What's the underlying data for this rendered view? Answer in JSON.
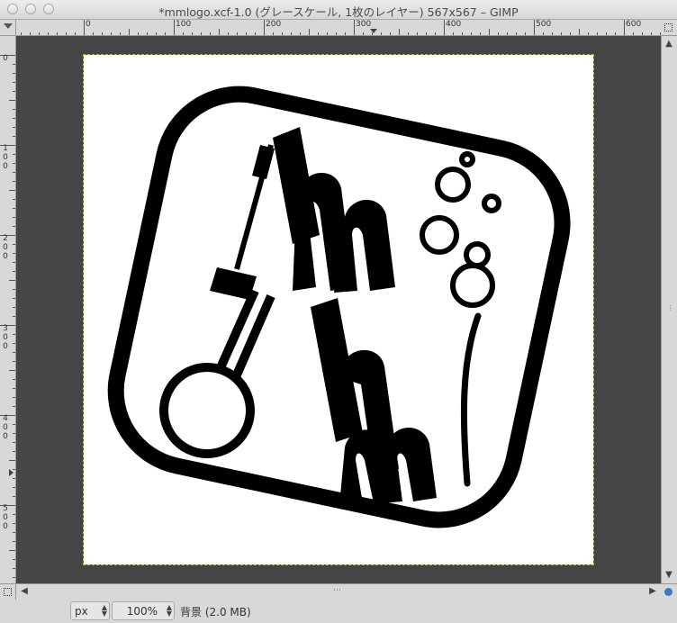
{
  "window": {
    "title": "*mmlogo.xcf-1.0 (グレースケール, 1枚のレイヤー) 567x567 – GIMP"
  },
  "ruler": {
    "h_labels": [
      "0",
      "100",
      "200",
      "300",
      "400",
      "500",
      "600"
    ],
    "v_labels": [
      [
        "0"
      ],
      [
        "1",
        "0",
        "0"
      ],
      [
        "2",
        "0",
        "0"
      ],
      [
        "3",
        "0",
        "0"
      ],
      [
        "4",
        "0",
        "0"
      ],
      [
        "5",
        "0",
        "0"
      ]
    ]
  },
  "statusbar": {
    "unit": "px",
    "zoom": "100%",
    "layer_info": "背景 (2.0 MB)"
  },
  "icons": {
    "menu": "triangle-down-icon",
    "navigate": "navigate-icon",
    "quick_mask": "quick-mask-icon",
    "zoom": "zoom-icon"
  },
  "colors": {
    "canvas_bg": "#454545",
    "image_bg": "#ffffff",
    "logo": "#000000",
    "selection": "#c8b400"
  }
}
